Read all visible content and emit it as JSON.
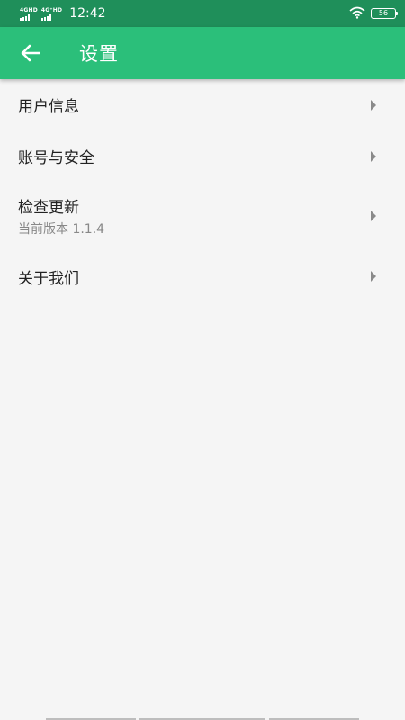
{
  "status_bar": {
    "signal1_label": "4GHD",
    "signal2_label": "4G⁺HD",
    "time": "12:42",
    "battery": "56"
  },
  "app_bar": {
    "title": "设置"
  },
  "settings": {
    "items": [
      {
        "label": "用户信息"
      },
      {
        "label": "账号与安全"
      },
      {
        "label": "检查更新",
        "sub": "当前版本 1.1.4"
      },
      {
        "label": "关于我们"
      }
    ]
  },
  "colors": {
    "status_bar": "#1f8f5a",
    "app_bar": "#2bbf7a",
    "background": "#f5f5f5"
  }
}
